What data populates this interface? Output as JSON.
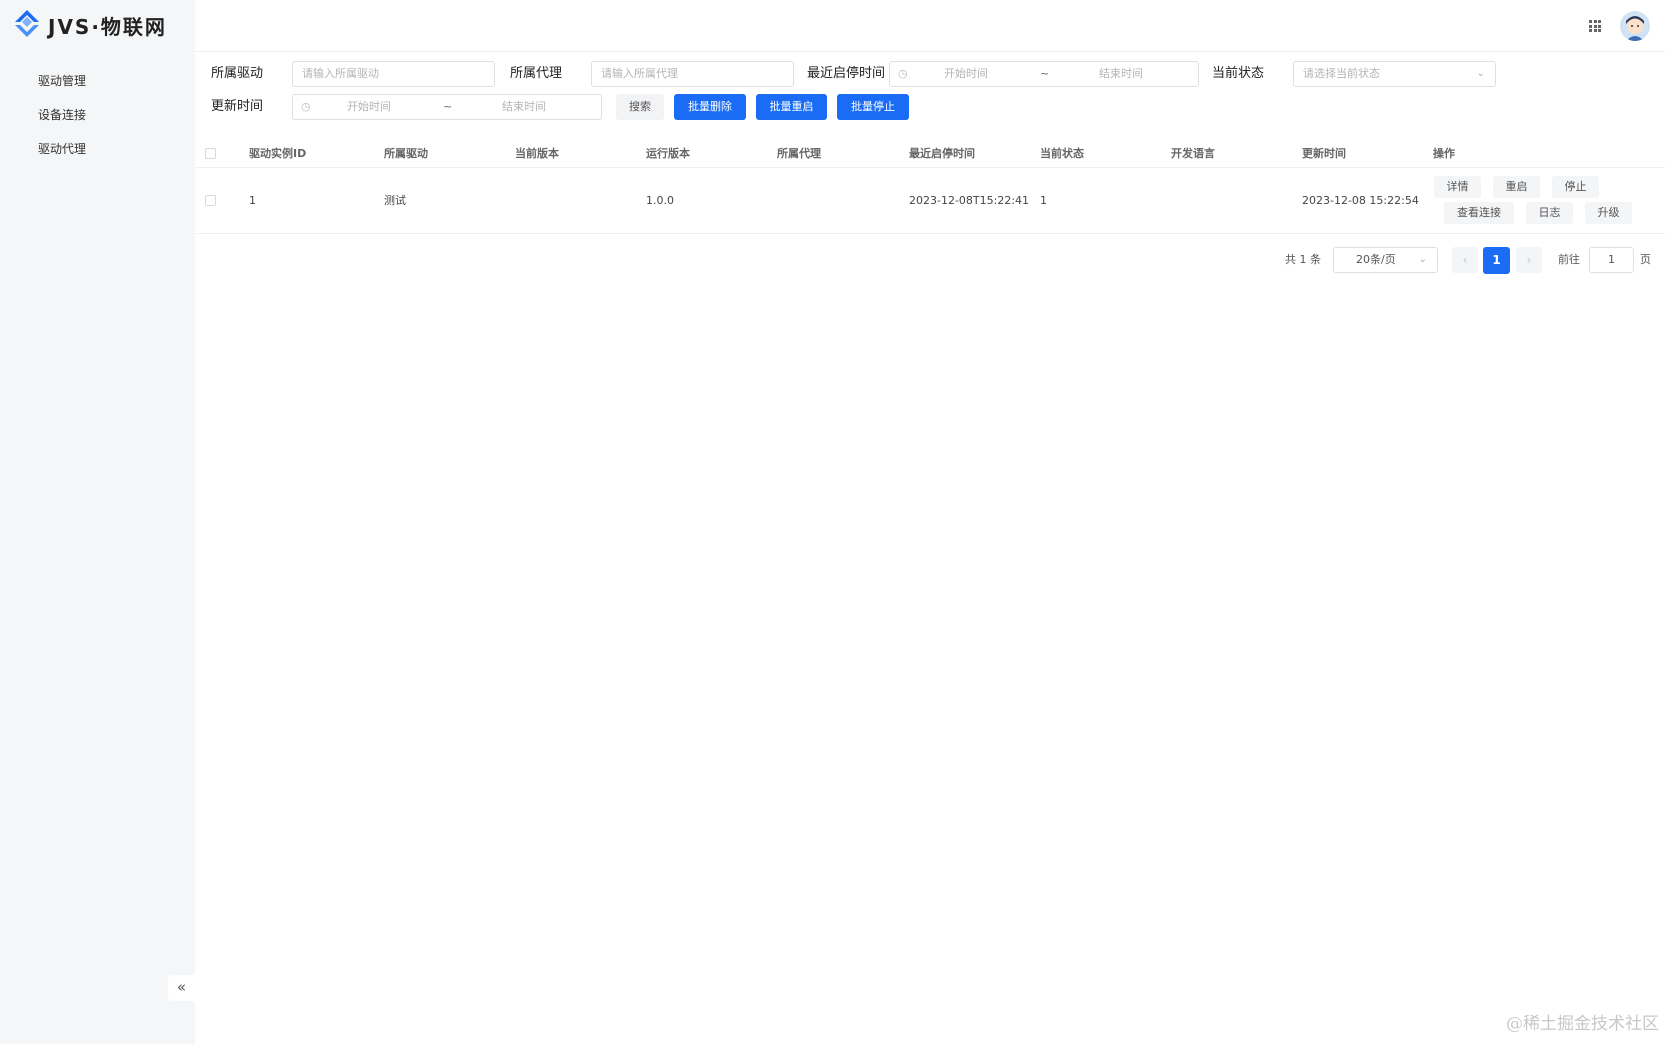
{
  "app": {
    "title": "JVS·物联网"
  },
  "sidebar": {
    "items": [
      {
        "label": "驱动管理"
      },
      {
        "label": "设备连接"
      },
      {
        "label": "驱动代理"
      }
    ],
    "collapse_label": "«"
  },
  "filters": {
    "driver_label": "所属驱动",
    "driver_placeholder": "请输入所属驱动",
    "proxy_label": "所属代理",
    "proxy_placeholder": "请输入所属代理",
    "restart_time_label": "最近启停时间",
    "restart_start": "开始时间",
    "restart_sep": "~",
    "restart_end": "结束时间",
    "status_label": "当前状态",
    "status_placeholder": "请选择当前状态",
    "update_time_label": "更新时间",
    "update_start": "开始时间",
    "update_sep": "~",
    "update_end": "结束时间"
  },
  "actions": {
    "search": "搜索",
    "batch_delete": "批量删除",
    "batch_restart": "批量重启",
    "batch_stop": "批量停止"
  },
  "table": {
    "columns": [
      "驱动实例ID",
      "所属驱动",
      "当前版本",
      "运行版本",
      "所属代理",
      "最近启停时间",
      "当前状态",
      "开发语言",
      "更新时间",
      "操作"
    ],
    "rows": [
      {
        "id": "1",
        "driver": "测试",
        "current_version": "",
        "run_version": "1.0.0",
        "proxy": "",
        "last_restart": "2023-12-08T15:22:41",
        "status": "1",
        "language": "",
        "updated": "2023-12-08 15:22:54",
        "ops": [
          "详情",
          "重启",
          "停止",
          "查看连接",
          "日志",
          "升级"
        ]
      }
    ]
  },
  "pagination": {
    "total_text": "共 1 条",
    "page_size": "20条/页",
    "current_page": "1",
    "goto_prefix": "前往",
    "goto_value": "1",
    "goto_suffix": "页",
    "prev": "‹",
    "next": "›"
  },
  "watermark": "@稀土掘金技术社区",
  "colors": {
    "primary": "#1a6cf5",
    "sidebar_bg": "#f5f6f7"
  },
  "icons": {
    "logo": "layers-diamond-icon",
    "apps": "grid-icon",
    "clock": "clock-icon",
    "avatar": "user-avatar"
  }
}
